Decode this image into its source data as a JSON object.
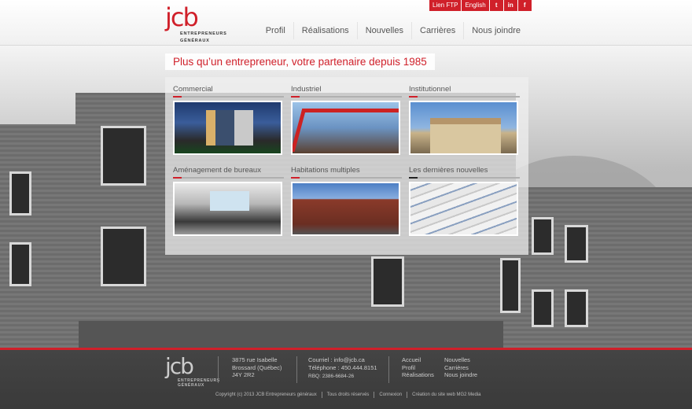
{
  "header": {
    "logo": {
      "mark": "jcb",
      "sub_line1": "ENTREPRENEURS",
      "sub_line2": "GÉNÉRAUX"
    },
    "topbar": {
      "ftp": "Lien FTP",
      "lang": "English",
      "twitter": "t",
      "linkedin": "in",
      "facebook": "f"
    },
    "nav": [
      "Profil",
      "Réalisations",
      "Nouvelles",
      "Carrières",
      "Nous joindre"
    ]
  },
  "tagline": "Plus qu’un entrepreneur, votre partenaire depuis 1985",
  "categories": [
    {
      "title": "Commercial"
    },
    {
      "title": "Industriel"
    },
    {
      "title": "Institutionnel"
    },
    {
      "title": "Aménagement de bureaux"
    },
    {
      "title": "Habitations multiples"
    },
    {
      "title": "Les dernières nouvelles"
    }
  ],
  "footer": {
    "logo": {
      "mark": "jcb",
      "sub_line1": "ENTREPRENEURS",
      "sub_line2": "GÉNÉRAUX"
    },
    "address": [
      "3875 rue Isabelle",
      "Brossard (Québec)",
      "J4Y 2R2"
    ],
    "contact": [
      "Courriel : info@jcb.ca",
      "Téléphone : 450.444.8151",
      "RBQ: 2386-6684-26"
    ],
    "links_col1": [
      "Accueil",
      "Profil",
      "Réalisations"
    ],
    "links_col2": [
      "Nouvelles",
      "Carrières",
      "Nous joindre"
    ],
    "bottom": [
      "Copyright (c) 2013 JCB Entrepreneurs généraux",
      "Tous droits réservés",
      "Connexion",
      "Création du site web MG2 Media"
    ]
  },
  "colors": {
    "accent": "#d0202a",
    "footer_bg": "#3f3f3f"
  }
}
